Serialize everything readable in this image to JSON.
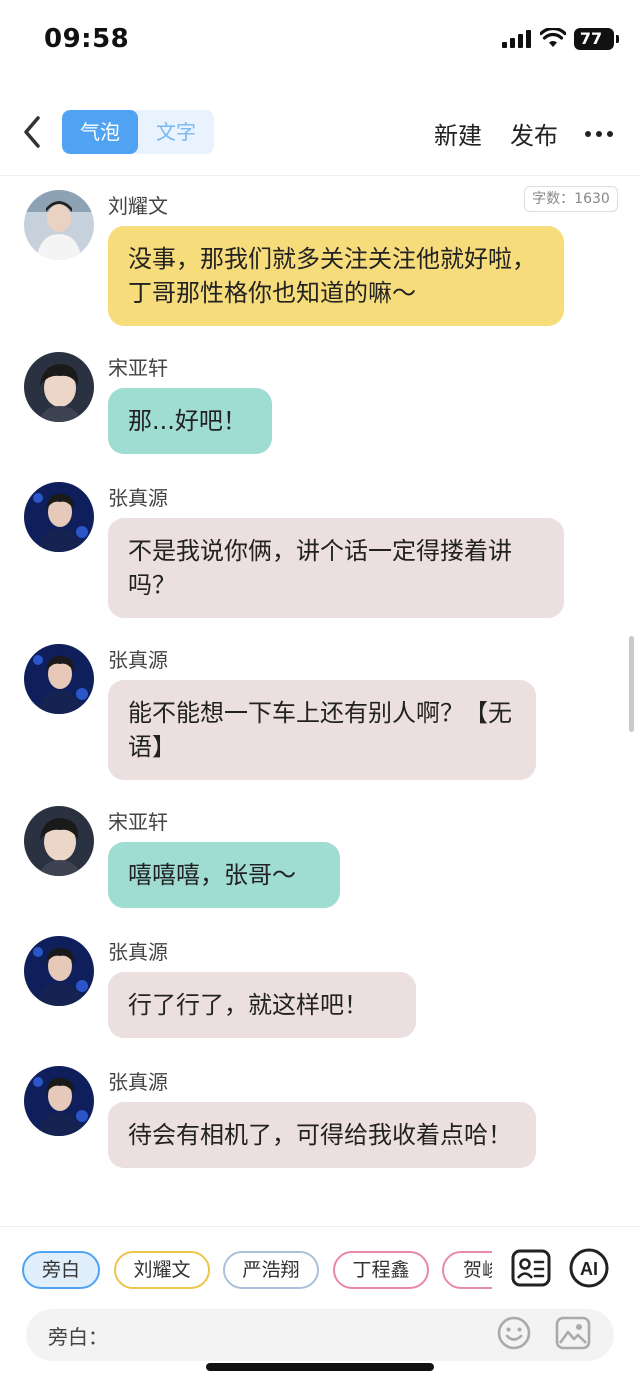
{
  "status": {
    "time": "09:58",
    "battery": "77"
  },
  "nav": {
    "tabs": [
      {
        "label": "气泡"
      },
      {
        "label": "文字"
      }
    ],
    "new_label": "新建",
    "publish_label": "发布"
  },
  "chat": {
    "word_count": "字数：1630",
    "messages": [
      {
        "name": "刘耀文",
        "text": "没事，那我们就多关注关注他就好啦，丁哥那性格你也知道的嘛～",
        "color": "#f7dc7c"
      },
      {
        "name": "宋亚轩",
        "text": "那...好吧！",
        "color": "#9fdcd2"
      },
      {
        "name": "张真源",
        "text": "不是我说你俩，讲个话一定得搂着讲吗？",
        "color": "#ecdfdf"
      },
      {
        "name": "张真源",
        "text": "能不能想一下车上还有别人啊？【无语】",
        "color": "#ecdfdf"
      },
      {
        "name": "宋亚轩",
        "text": "嘻嘻嘻，张哥～",
        "color": "#9fdcd2"
      },
      {
        "name": "张真源",
        "text": "行了行了，就这样吧！",
        "color": "#ecdfdf"
      },
      {
        "name": "张真源",
        "text": "待会有相机了，可得给我收着点哈！",
        "color": "#ecdfdf"
      }
    ]
  },
  "roles": [
    {
      "label": "旁白"
    },
    {
      "label": "刘耀文"
    },
    {
      "label": "严浩翔"
    },
    {
      "label": "丁程鑫"
    },
    {
      "label": "贺峻"
    }
  ],
  "input": {
    "label": "旁白："
  },
  "icons": {
    "back": "chevron-left-icon",
    "more": "more-icon",
    "contact": "contact-card-icon",
    "ai": "ai-icon",
    "emoji": "smiley-icon",
    "image": "image-icon"
  }
}
